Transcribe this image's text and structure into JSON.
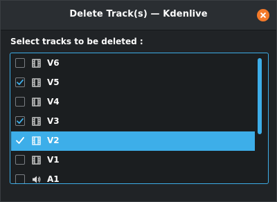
{
  "window": {
    "title": "Delete Track(s) — Kdenlive"
  },
  "prompt": "Select tracks to be deleted :",
  "colors": {
    "accent": "#3daee9",
    "close": "#f47a2a",
    "background": "#202326"
  },
  "tracks": [
    {
      "label": "V6",
      "checked": false,
      "selected": false,
      "icon": "video-track-icon"
    },
    {
      "label": "V5",
      "checked": true,
      "selected": false,
      "icon": "video-track-icon"
    },
    {
      "label": "V4",
      "checked": false,
      "selected": false,
      "icon": "video-track-icon"
    },
    {
      "label": "V3",
      "checked": true,
      "selected": false,
      "icon": "video-track-icon"
    },
    {
      "label": "V2",
      "checked": true,
      "selected": true,
      "icon": "video-track-icon"
    },
    {
      "label": "V1",
      "checked": false,
      "selected": false,
      "icon": "video-track-icon"
    },
    {
      "label": "A1",
      "checked": false,
      "selected": false,
      "icon": "audio-track-icon"
    }
  ],
  "scrollbar": {
    "visible_fraction": 0.63
  }
}
